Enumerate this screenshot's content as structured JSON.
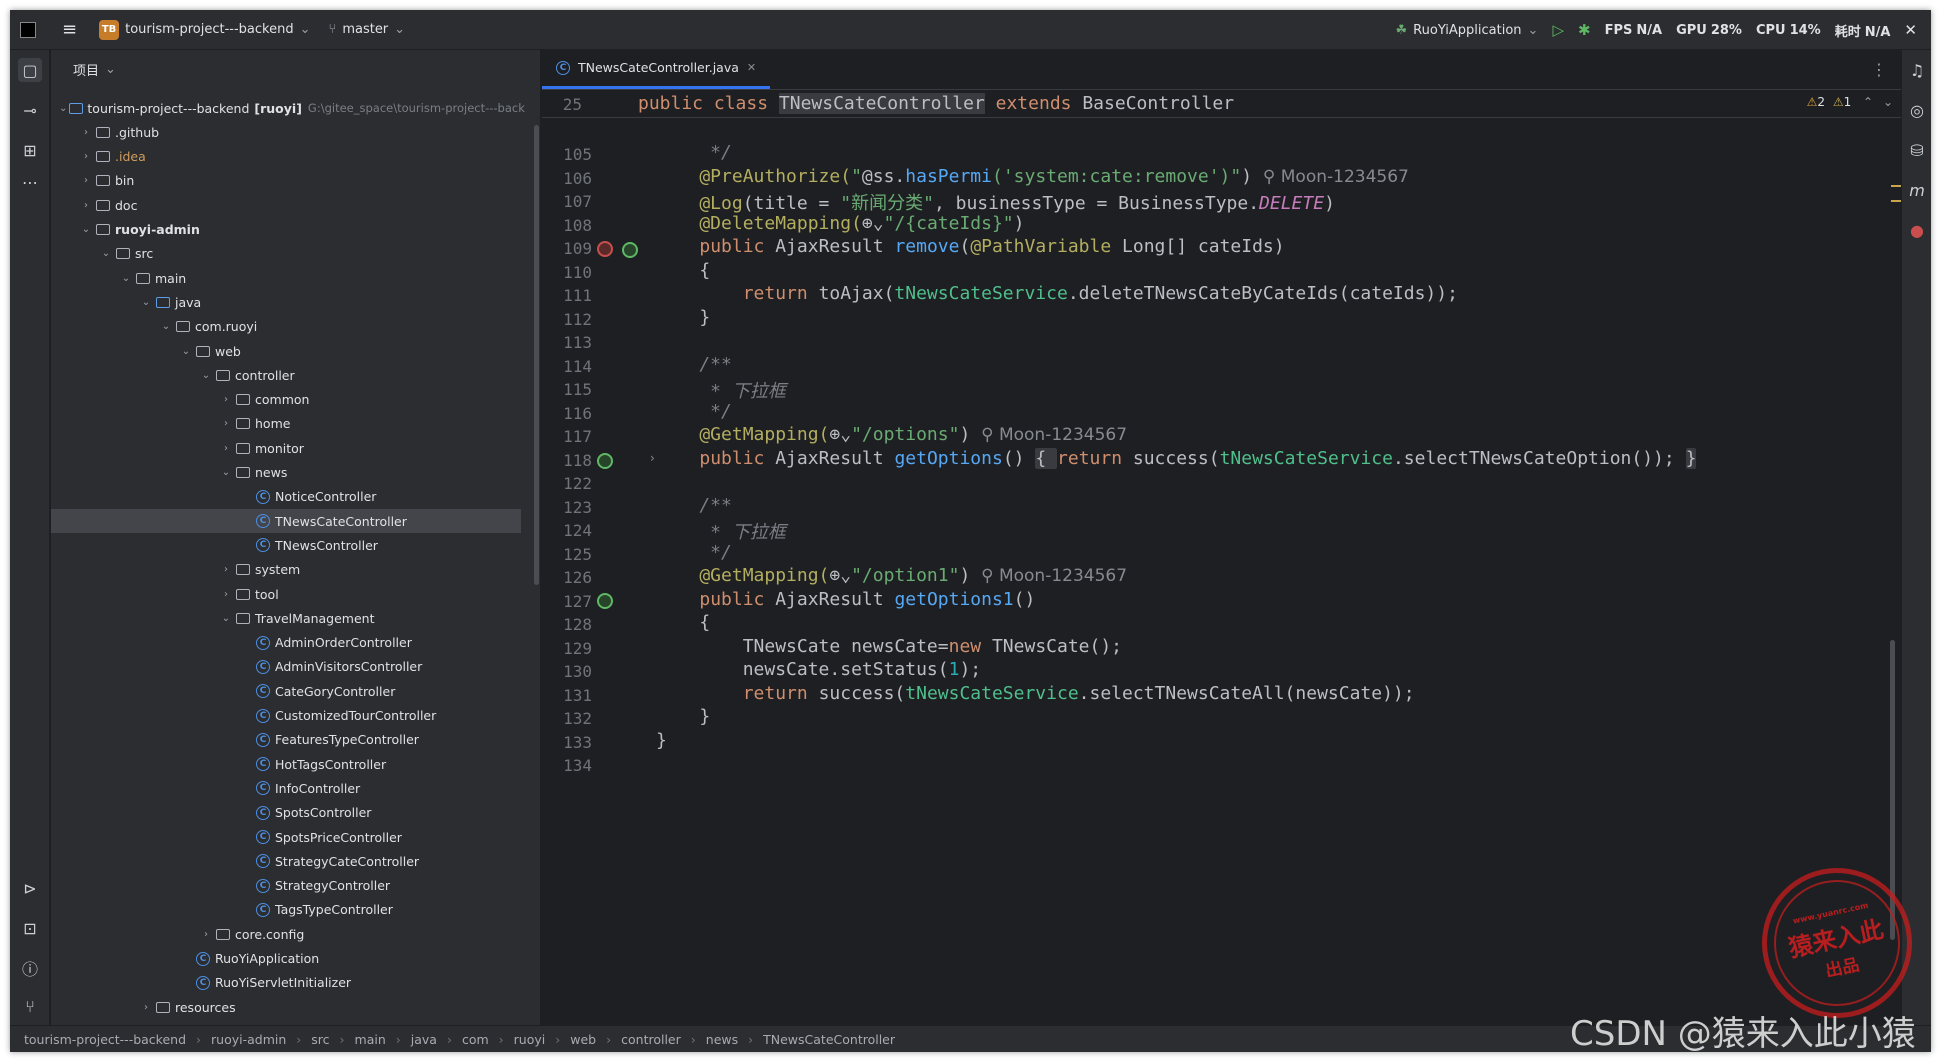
{
  "titlebar": {
    "project_badge": "TB",
    "project_name": "tourism-project---backend",
    "branch": "master",
    "run_config": "RuoYiApplication",
    "fps_label": "FPS",
    "fps_value": "N/A",
    "gpu_label": "GPU",
    "gpu_value": "28%",
    "cpu_label": "CPU",
    "cpu_value": "14%",
    "time_label": "耗时",
    "time_value": "N/A"
  },
  "project_panel": {
    "title": "项目",
    "root": {
      "name": "tourism-project---backend",
      "module": "[ruoyi]",
      "path": "G:\\gitee_space\\tourism-project---back"
    },
    "nodes": [
      {
        "label": ".github",
        "depth": 1,
        "kind": "folder",
        "arrow": "›"
      },
      {
        "label": ".idea",
        "depth": 1,
        "kind": "folder",
        "arrow": "›",
        "style": "orange"
      },
      {
        "label": "bin",
        "depth": 1,
        "kind": "folder",
        "arrow": "›"
      },
      {
        "label": "doc",
        "depth": 1,
        "kind": "folder",
        "arrow": "›"
      },
      {
        "label": "ruoyi-admin",
        "depth": 1,
        "kind": "folder",
        "arrow": "⌄",
        "style": "bold"
      },
      {
        "label": "src",
        "depth": 2,
        "kind": "folder",
        "arrow": "⌄"
      },
      {
        "label": "main",
        "depth": 3,
        "kind": "folder",
        "arrow": "⌄"
      },
      {
        "label": "java",
        "depth": 4,
        "kind": "folder-blue",
        "arrow": "⌄"
      },
      {
        "label": "com.ruoyi",
        "depth": 5,
        "kind": "folder",
        "arrow": "⌄"
      },
      {
        "label": "web",
        "depth": 6,
        "kind": "folder",
        "arrow": "⌄"
      },
      {
        "label": "controller",
        "depth": 7,
        "kind": "folder",
        "arrow": "⌄"
      },
      {
        "label": "common",
        "depth": 8,
        "kind": "folder",
        "arrow": "›"
      },
      {
        "label": "home",
        "depth": 8,
        "kind": "folder",
        "arrow": "›"
      },
      {
        "label": "monitor",
        "depth": 8,
        "kind": "folder",
        "arrow": "›"
      },
      {
        "label": "news",
        "depth": 8,
        "kind": "folder",
        "arrow": "⌄"
      },
      {
        "label": "NoticeController",
        "depth": 9,
        "kind": "class",
        "arrow": ""
      },
      {
        "label": "TNewsCateController",
        "depth": 9,
        "kind": "class",
        "arrow": "",
        "selected": true
      },
      {
        "label": "TNewsController",
        "depth": 9,
        "kind": "class",
        "arrow": ""
      },
      {
        "label": "system",
        "depth": 8,
        "kind": "folder",
        "arrow": "›"
      },
      {
        "label": "tool",
        "depth": 8,
        "kind": "folder",
        "arrow": "›"
      },
      {
        "label": "TravelManagement",
        "depth": 8,
        "kind": "folder",
        "arrow": "⌄"
      },
      {
        "label": "AdminOrderController",
        "depth": 9,
        "kind": "class",
        "arrow": ""
      },
      {
        "label": "AdminVisitorsController",
        "depth": 9,
        "kind": "class",
        "arrow": ""
      },
      {
        "label": "CateGoryController",
        "depth": 9,
        "kind": "class",
        "arrow": ""
      },
      {
        "label": "CustomizedTourController",
        "depth": 9,
        "kind": "class",
        "arrow": ""
      },
      {
        "label": "FeaturesTypeController",
        "depth": 9,
        "kind": "class",
        "arrow": ""
      },
      {
        "label": "HotTagsController",
        "depth": 9,
        "kind": "class",
        "arrow": ""
      },
      {
        "label": "InfoController",
        "depth": 9,
        "kind": "class",
        "arrow": ""
      },
      {
        "label": "SpotsController",
        "depth": 9,
        "kind": "class",
        "arrow": ""
      },
      {
        "label": "SpotsPriceController",
        "depth": 9,
        "kind": "class",
        "arrow": ""
      },
      {
        "label": "StrategyCateController",
        "depth": 9,
        "kind": "class",
        "arrow": ""
      },
      {
        "label": "StrategyController",
        "depth": 9,
        "kind": "class",
        "arrow": ""
      },
      {
        "label": "TagsTypeController",
        "depth": 9,
        "kind": "class",
        "arrow": ""
      },
      {
        "label": "core.config",
        "depth": 7,
        "kind": "folder",
        "arrow": "›"
      },
      {
        "label": "RuoYiApplication",
        "depth": 6,
        "kind": "class",
        "arrow": ""
      },
      {
        "label": "RuoYiServletInitializer",
        "depth": 6,
        "kind": "class",
        "arrow": ""
      },
      {
        "label": "resources",
        "depth": 4,
        "kind": "folder",
        "arrow": "›"
      }
    ]
  },
  "editor": {
    "tab_label": "TNewsCateController.java",
    "sticky_line_no": "25",
    "sticky_tokens": [
      {
        "t": "public class ",
        "c": "kw"
      },
      {
        "t": "TNewsCateController",
        "c": "cls"
      },
      {
        "t": " extends ",
        "c": "kw"
      },
      {
        "t": "BaseController",
        "c": ""
      }
    ],
    "inspections": {
      "warnings": "2",
      "weak": "1"
    },
    "lines": [
      {
        "no": "105",
        "tokens": [
          {
            "t": "     */",
            "c": "cmt"
          }
        ]
      },
      {
        "no": "106",
        "tokens": [
          {
            "t": "    @PreAuthorize(",
            "c": "ann"
          },
          {
            "t": "\"",
            "c": "str"
          },
          {
            "t": "@ss.",
            "c": ""
          },
          {
            "t": "hasPermi",
            "c": "fn"
          },
          {
            "t": "('system:cate:remove')",
            "c": "str"
          },
          {
            "t": "\"",
            "c": "str"
          },
          {
            "t": ")",
            "c": ""
          },
          {
            "t": "  ⚲ Moon-1234567",
            "c": "hint"
          }
        ]
      },
      {
        "no": "107",
        "tokens": [
          {
            "t": "    @Log",
            "c": "ann"
          },
          {
            "t": "(title = ",
            "c": ""
          },
          {
            "t": "\"新闻分类\"",
            "c": "str"
          },
          {
            "t": ", businessType = BusinessType.",
            "c": ""
          },
          {
            "t": "DELETE",
            "c": "sta"
          },
          {
            "t": ")",
            "c": ""
          }
        ]
      },
      {
        "no": "108",
        "tokens": [
          {
            "t": "    @DeleteMapping(",
            "c": "ann"
          },
          {
            "t": "⊕⌄",
            "c": ""
          },
          {
            "t": "\"/{cateIds}\"",
            "c": "str"
          },
          {
            "t": ")",
            "c": ""
          }
        ]
      },
      {
        "no": "109",
        "tokens": [
          {
            "t": "    ",
            "c": ""
          },
          {
            "t": "public ",
            "c": "kw"
          },
          {
            "t": "AjaxResult ",
            "c": ""
          },
          {
            "t": "remove",
            "c": "fn"
          },
          {
            "t": "(",
            "c": ""
          },
          {
            "t": "@PathVariable",
            "c": "ann"
          },
          {
            "t": " Long[] cateIds)",
            "c": ""
          }
        ]
      },
      {
        "no": "110",
        "tokens": [
          {
            "t": "    {",
            "c": ""
          }
        ]
      },
      {
        "no": "111",
        "tokens": [
          {
            "t": "        ",
            "c": ""
          },
          {
            "t": "return ",
            "c": "kw"
          },
          {
            "t": "toAjax(",
            "c": ""
          },
          {
            "t": "tNewsCateService",
            "c": "svc"
          },
          {
            "t": ".deleteTNewsCateByCateIds(cateIds));",
            "c": ""
          }
        ]
      },
      {
        "no": "112",
        "tokens": [
          {
            "t": "    }",
            "c": ""
          }
        ]
      },
      {
        "no": "113",
        "tokens": []
      },
      {
        "no": "114",
        "tokens": [
          {
            "t": "    /**",
            "c": "cmt"
          }
        ]
      },
      {
        "no": "115",
        "tokens": [
          {
            "t": "     * 下拉框",
            "c": "cmt"
          }
        ]
      },
      {
        "no": "116",
        "tokens": [
          {
            "t": "     */",
            "c": "cmt"
          }
        ]
      },
      {
        "no": "117",
        "tokens": [
          {
            "t": "    @GetMapping(",
            "c": "ann"
          },
          {
            "t": "⊕⌄",
            "c": ""
          },
          {
            "t": "\"/options\"",
            "c": "str"
          },
          {
            "t": ")",
            "c": ""
          },
          {
            "t": "  ⚲ Moon-1234567",
            "c": "hint"
          }
        ]
      },
      {
        "no": "118",
        "tokens": [
          {
            "t": "    ",
            "c": ""
          },
          {
            "t": "public ",
            "c": "kw"
          },
          {
            "t": "AjaxResult ",
            "c": ""
          },
          {
            "t": "getOptions",
            "c": "fn"
          },
          {
            "t": "() ",
            "c": ""
          },
          {
            "t": "{ ",
            "c": "fold"
          },
          {
            "t": "return ",
            "c": "kw"
          },
          {
            "t": "success(",
            "c": ""
          },
          {
            "t": "tNewsCateService",
            "c": "svc"
          },
          {
            "t": ".selectTNewsCateOption()); ",
            "c": ""
          },
          {
            "t": "}",
            "c": "fold"
          }
        ]
      },
      {
        "no": "122",
        "tokens": []
      },
      {
        "no": "123",
        "tokens": [
          {
            "t": "    /**",
            "c": "cmt"
          }
        ]
      },
      {
        "no": "124",
        "tokens": [
          {
            "t": "     * 下拉框",
            "c": "cmt"
          }
        ]
      },
      {
        "no": "125",
        "tokens": [
          {
            "t": "     */",
            "c": "cmt"
          }
        ]
      },
      {
        "no": "126",
        "tokens": [
          {
            "t": "    @GetMapping(",
            "c": "ann"
          },
          {
            "t": "⊕⌄",
            "c": ""
          },
          {
            "t": "\"/option1\"",
            "c": "str"
          },
          {
            "t": ")",
            "c": ""
          },
          {
            "t": "  ⚲ Moon-1234567",
            "c": "hint"
          }
        ]
      },
      {
        "no": "127",
        "tokens": [
          {
            "t": "    ",
            "c": ""
          },
          {
            "t": "public ",
            "c": "kw"
          },
          {
            "t": "AjaxResult ",
            "c": ""
          },
          {
            "t": "getOptions1",
            "c": "fn"
          },
          {
            "t": "()",
            "c": ""
          }
        ]
      },
      {
        "no": "128",
        "tokens": [
          {
            "t": "    {",
            "c": ""
          }
        ]
      },
      {
        "no": "129",
        "tokens": [
          {
            "t": "        TNewsCate newsCate=",
            "c": ""
          },
          {
            "t": "new ",
            "c": "kw"
          },
          {
            "t": "TNewsCate();",
            "c": ""
          }
        ]
      },
      {
        "no": "130",
        "tokens": [
          {
            "t": "        newsCate.setStatus(",
            "c": ""
          },
          {
            "t": "1",
            "c": "num"
          },
          {
            "t": ");",
            "c": ""
          }
        ]
      },
      {
        "no": "131",
        "tokens": [
          {
            "t": "        ",
            "c": ""
          },
          {
            "t": "return ",
            "c": "kw"
          },
          {
            "t": "success(",
            "c": ""
          },
          {
            "t": "tNewsCateService",
            "c": "svc"
          },
          {
            "t": ".selectTNewsCateAll(newsCate));",
            "c": ""
          }
        ]
      },
      {
        "no": "132",
        "tokens": [
          {
            "t": "    }",
            "c": ""
          }
        ]
      },
      {
        "no": "133",
        "tokens": [
          {
            "t": "}",
            "c": ""
          }
        ]
      },
      {
        "no": "134",
        "tokens": []
      }
    ]
  },
  "statusbar": {
    "crumbs": [
      "tourism-project---backend",
      "ruoyi-admin",
      "src",
      "main",
      "java",
      "com",
      "ruoyi",
      "web",
      "controller",
      "news",
      "TNewsCateController"
    ]
  },
  "overlay": {
    "stamp_url": "www.yuanrc.com",
    "stamp_main": "猿来入此",
    "stamp_sub": "出品",
    "watermark": "CSDN @猿来入此小猿"
  }
}
